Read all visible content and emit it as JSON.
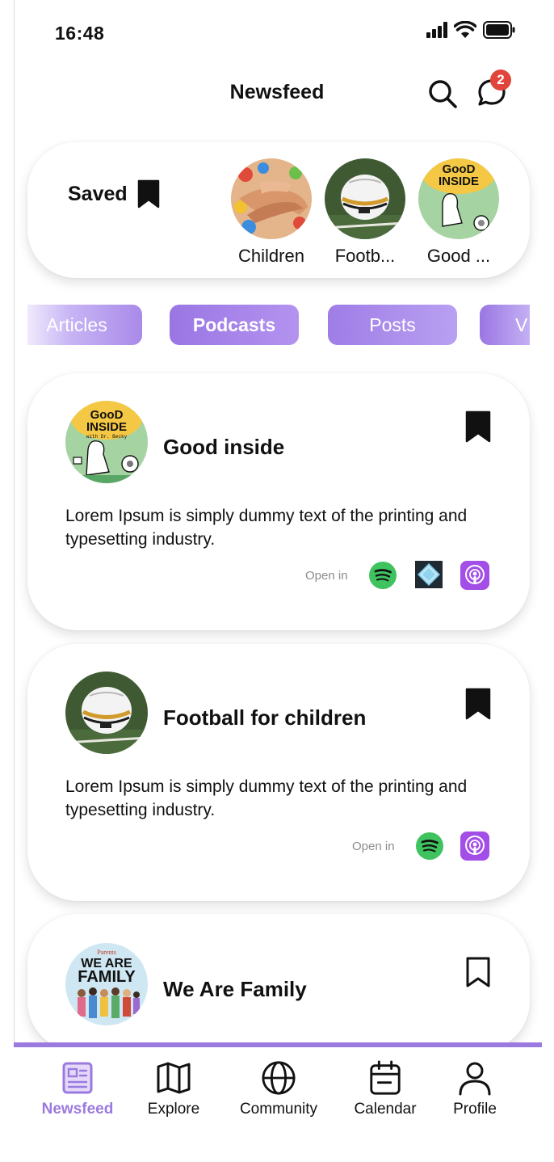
{
  "status": {
    "time": "16:48"
  },
  "header": {
    "title": "Newsfeed",
    "badge_count": "2"
  },
  "saved": {
    "label": "Saved",
    "items": [
      {
        "caption": "Children",
        "icon": "children-hands-image"
      },
      {
        "caption": "Footb...",
        "icon": "football-image"
      },
      {
        "caption": "Good ...",
        "icon": "good-inside-image"
      }
    ]
  },
  "tabs": [
    {
      "label": "Articles",
      "active": false
    },
    {
      "label": "Podcasts",
      "active": true
    },
    {
      "label": "Posts",
      "active": false
    },
    {
      "label": "V",
      "active": false
    }
  ],
  "cards": [
    {
      "title": "Good inside",
      "description": "Lorem Ipsum is simply dummy text of the printing and typesetting industry.",
      "open_in": "Open in",
      "bookmarked": true,
      "services": [
        "spotify-icon",
        "diamond-app-icon",
        "apple-podcasts-icon"
      ]
    },
    {
      "title": "Football for children",
      "description": "Lorem Ipsum is simply dummy text of the printing and typesetting industry.",
      "open_in": "Open in",
      "bookmarked": true,
      "services": [
        "spotify-icon",
        "apple-podcasts-icon"
      ]
    },
    {
      "title": "We Are Family",
      "bookmarked": false
    }
  ],
  "podcast_art": {
    "good_inside": {
      "line1": "GooD",
      "line2": "INSIDE",
      "line3": "with Dr. Becky"
    },
    "we_are_family": {
      "line0": "Parents",
      "line1": "WE ARE",
      "line2": "FAMILY"
    }
  },
  "nav": {
    "items": [
      {
        "label": "Newsfeed",
        "icon": "newsfeed-icon",
        "active": true
      },
      {
        "label": "Explore",
        "icon": "map-icon",
        "active": false
      },
      {
        "label": "Community",
        "icon": "globe-icon",
        "active": false
      },
      {
        "label": "Calendar",
        "icon": "calendar-icon",
        "active": false
      },
      {
        "label": "Profile",
        "icon": "profile-icon",
        "active": false
      }
    ]
  },
  "colors": {
    "accent": "#9b7ae0",
    "badge": "#e0443a",
    "spotify": "#3fc35f",
    "podcasts": "#a34ee6"
  }
}
